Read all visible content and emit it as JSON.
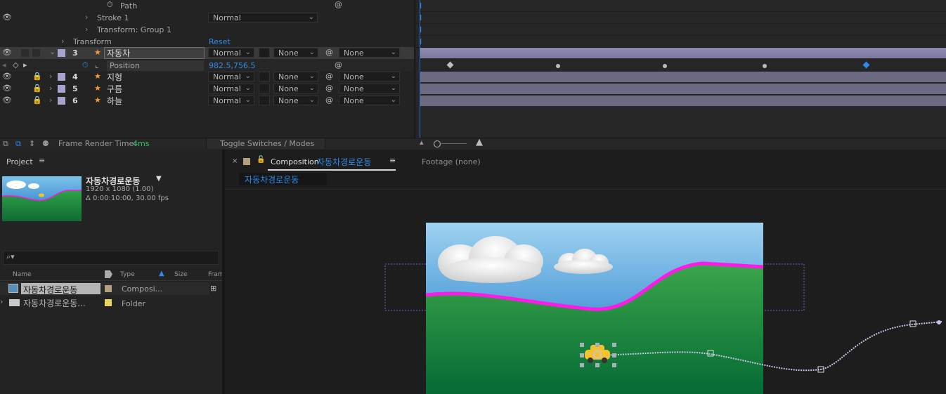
{
  "timeline": {
    "rows": {
      "path": {
        "label": "Path"
      },
      "stroke": {
        "label": "Stroke 1",
        "mode": "Normal"
      },
      "transform_group": {
        "label": "Transform: Group 1"
      },
      "transform": {
        "label": "Transform",
        "reset": "Reset"
      },
      "position": {
        "label": "Position",
        "value": "982.5,756.5"
      }
    },
    "layers": [
      {
        "num": "3",
        "name": "자동차",
        "mode": "Normal",
        "trkmat": "None",
        "parent": "None"
      },
      {
        "num": "4",
        "name": "지형",
        "mode": "Normal",
        "trkmat": "None",
        "parent": "None"
      },
      {
        "num": "5",
        "name": "구름",
        "mode": "Normal",
        "trkmat": "None",
        "parent": "None"
      },
      {
        "num": "6",
        "name": "하늘",
        "mode": "Normal",
        "trkmat": "None",
        "parent": "None"
      }
    ]
  },
  "statusbar": {
    "render_label": "Frame Render Time:",
    "render_value": "4ms",
    "toggle": "Toggle Switches / Modes"
  },
  "project": {
    "tab": "Project",
    "comp_name": "자동차경로운동",
    "comp_res": "1920 x 1080 (1.00)",
    "comp_dur": "Δ 0:00:10:00, 30.00 fps",
    "columns": {
      "name": "Name",
      "type": "Type",
      "size": "Size",
      "frame": "Fram"
    },
    "items": [
      {
        "name": "자동차경로운동",
        "type": "Composi..."
      },
      {
        "name": "자동차경로운동...",
        "type": "Folder"
      }
    ]
  },
  "composition": {
    "tab_prefix": "Composition",
    "tab_name": "자동차경로운동",
    "footage": "Footage  (none)",
    "breadcrumb": "자동차경로운동"
  },
  "colors": {
    "accent": "#2d8ceb",
    "path_magenta": "#ff19e6",
    "grass": "#1f8a3f",
    "sky": "#2a8fd6",
    "label_lavender": "#a6a4cc",
    "label_tan": "#b5a07d",
    "label_yellow": "#e8d55a"
  }
}
